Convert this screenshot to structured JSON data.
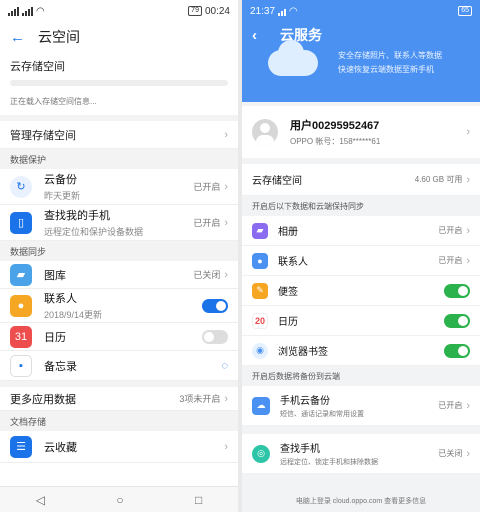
{
  "left": {
    "status": {
      "time": "00:24",
      "battery": "79"
    },
    "header": {
      "title": "云空间"
    },
    "storage": {
      "title": "云存储空间",
      "loading": "正在载入存储空间信息..."
    },
    "manage": {
      "label": "管理存储空间"
    },
    "sections": {
      "protect": "数据保护",
      "sync": "数据同步",
      "docs": "文档存储"
    },
    "backup": {
      "title": "云备份",
      "sub": "昨天更新",
      "status": "已开启"
    },
    "findphone": {
      "title": "查找我的手机",
      "sub": "远程定位和保护设备数据",
      "status": "已开启"
    },
    "sync_items": [
      {
        "label": "图库",
        "status": "已关闭"
      },
      {
        "label": "联系人",
        "sub": "2018/9/14更新",
        "toggle": "on"
      },
      {
        "label": "日历",
        "toggle": "off"
      },
      {
        "label": "备忘录"
      }
    ],
    "more": {
      "label": "更多应用数据",
      "value": "3项未开启"
    },
    "favorites": {
      "label": "云收藏"
    },
    "calendar_icon_text": "31"
  },
  "right": {
    "status": {
      "time": "21:37",
      "battery": "65"
    },
    "header": {
      "title": "云服务"
    },
    "banner": {
      "line1": "安全存储照片、联系人等数据",
      "line2": "快速恢复云端数据至新手机"
    },
    "user": {
      "name": "用户00295952467",
      "account": "OPPO 帐号：158******61"
    },
    "storage": {
      "label": "云存储空间",
      "value": "4.60 GB 可用"
    },
    "sections": {
      "sync": "开启后以下数据和云端保持同步",
      "backup": "开启后数据将备份到云端"
    },
    "sync_items": [
      {
        "label": "相册",
        "status": "已开启"
      },
      {
        "label": "联系人",
        "status": "已开启"
      },
      {
        "label": "便签",
        "toggle": "on"
      },
      {
        "label": "日历",
        "toggle": "on"
      },
      {
        "label": "浏览器书签",
        "toggle": "on"
      }
    ],
    "calendar_icon_text": "20",
    "backup": {
      "title": "手机云备份",
      "sub": "短信、通话记录和常用设置",
      "status": "已开启"
    },
    "find": {
      "title": "查找手机",
      "sub": "远程定位、锁定手机和抹除数据",
      "status": "已关闭"
    },
    "footer": "电脑上登录 cloud.oppo.com 查看更多信息"
  },
  "colors": {
    "accent_left": "#1a73e8",
    "accent_right": "#4a91f2",
    "toggle_green": "#2bb24c"
  }
}
